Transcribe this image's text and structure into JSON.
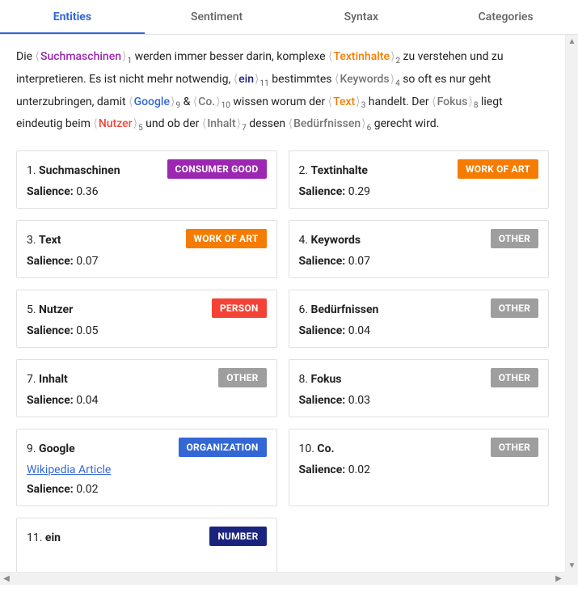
{
  "tabs": {
    "items": [
      {
        "label": "Entities",
        "active": true
      },
      {
        "label": "Sentiment",
        "active": false
      },
      {
        "label": "Syntax",
        "active": false
      },
      {
        "label": "Categories",
        "active": false
      }
    ]
  },
  "paragraph": {
    "tokens": [
      {
        "t": "text",
        "value": "Die "
      },
      {
        "t": "entity",
        "name": "Suchmaschinen",
        "idx": 1,
        "cat": "consumer_good"
      },
      {
        "t": "text",
        "value": " werden immer besser darin, komplexe "
      },
      {
        "t": "entity",
        "name": "Textinhalte",
        "idx": 2,
        "cat": "work_of_art"
      },
      {
        "t": "text",
        "value": " zu verstehen und zu interpretieren. Es ist nicht mehr notwendig, "
      },
      {
        "t": "entity",
        "name": "ein",
        "idx": 11,
        "cat": "number"
      },
      {
        "t": "text",
        "value": " bestimmtes "
      },
      {
        "t": "entity",
        "name": "Keywords",
        "idx": 4,
        "cat": "other"
      },
      {
        "t": "text",
        "value": " so oft es nur geht unterzubringen, damit "
      },
      {
        "t": "entity",
        "name": "Google",
        "idx": 9,
        "cat": "organization"
      },
      {
        "t": "text",
        "value": " & "
      },
      {
        "t": "entity",
        "name": "Co.",
        "idx": 10,
        "cat": "other"
      },
      {
        "t": "text",
        "value": " wissen worum der "
      },
      {
        "t": "entity",
        "name": "Text",
        "idx": 3,
        "cat": "work_of_art"
      },
      {
        "t": "text",
        "value": " handelt. Der "
      },
      {
        "t": "entity",
        "name": "Fokus",
        "idx": 8,
        "cat": "other"
      },
      {
        "t": "text",
        "value": " liegt eindeutig beim "
      },
      {
        "t": "entity",
        "name": "Nutzer",
        "idx": 5,
        "cat": "person"
      },
      {
        "t": "text",
        "value": " und ob der "
      },
      {
        "t": "entity",
        "name": "Inhalt",
        "idx": 7,
        "cat": "other"
      },
      {
        "t": "text",
        "value": " dessen "
      },
      {
        "t": "entity",
        "name": "Bedürfnissen",
        "idx": 6,
        "cat": "other"
      },
      {
        "t": "text",
        "value": " gerecht wird."
      }
    ]
  },
  "labels": {
    "salience": "Salience:",
    "cat": {
      "consumer_good": "CONSUMER GOOD",
      "work_of_art": "WORK OF ART",
      "person": "PERSON",
      "other": "OTHER",
      "organization": "ORGANIZATION",
      "number": "NUMBER"
    }
  },
  "entities": [
    {
      "idx": 1,
      "name": "Suchmaschinen",
      "cat": "consumer_good",
      "salience": "0.36"
    },
    {
      "idx": 2,
      "name": "Textinhalte",
      "cat": "work_of_art",
      "salience": "0.29"
    },
    {
      "idx": 3,
      "name": "Text",
      "cat": "work_of_art",
      "salience": "0.07"
    },
    {
      "idx": 4,
      "name": "Keywords",
      "cat": "other",
      "salience": "0.07"
    },
    {
      "idx": 5,
      "name": "Nutzer",
      "cat": "person",
      "salience": "0.05"
    },
    {
      "idx": 6,
      "name": "Bedürfnissen",
      "cat": "other",
      "salience": "0.04"
    },
    {
      "idx": 7,
      "name": "Inhalt",
      "cat": "other",
      "salience": "0.04"
    },
    {
      "idx": 8,
      "name": "Fokus",
      "cat": "other",
      "salience": "0.03"
    },
    {
      "idx": 9,
      "name": "Google",
      "cat": "organization",
      "salience": "0.02",
      "link_text": "Wikipedia Article"
    },
    {
      "idx": 10,
      "name": "Co.",
      "cat": "other",
      "salience": "0.02"
    },
    {
      "idx": 11,
      "name": "ein",
      "cat": "number"
    }
  ]
}
